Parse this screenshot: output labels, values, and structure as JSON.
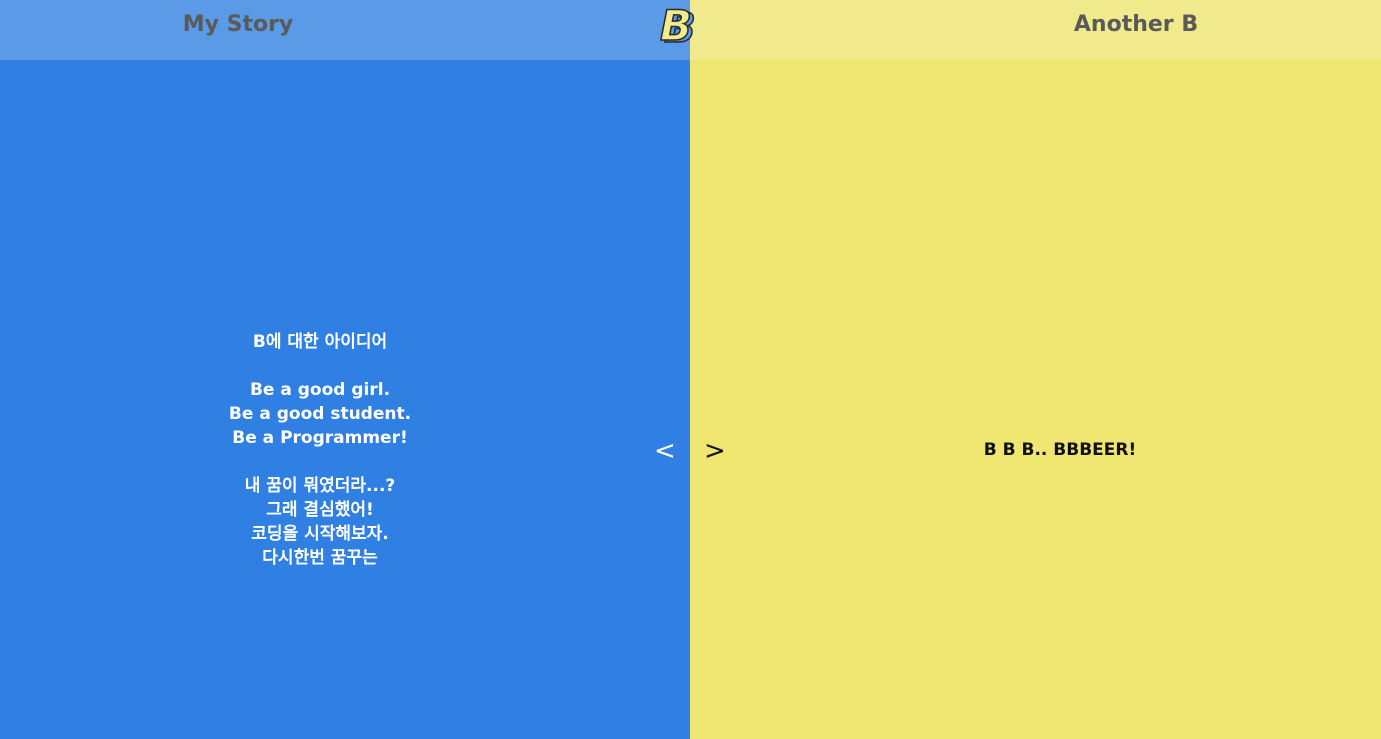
{
  "header": {
    "left_link": "My Story",
    "right_link": "Another B",
    "logo_letter": "B",
    "logo_colors": {
      "fill": "#f3ec8a",
      "stroke": "#2a2a2a",
      "accent": "#5a9ae6"
    }
  },
  "left_panel": {
    "background": "#2f80e2",
    "lines": [
      "B에 대한 아이디어",
      "",
      "Be a good girl.",
      "Be a good student.",
      "Be a Programmer!",
      "",
      "내 꿈이 뭐였더라...?",
      "그래 결심했어!",
      "코딩을 시작해보자.",
      "다시한번 꿈꾸는"
    ]
  },
  "right_panel": {
    "background": "#efe672",
    "text": "B B B.. BBBEER!"
  },
  "controls": {
    "prev_icon": "chevron-left-icon",
    "prev_glyph": "<",
    "next_icon": "chevron-right-icon",
    "next_glyph": ">"
  }
}
